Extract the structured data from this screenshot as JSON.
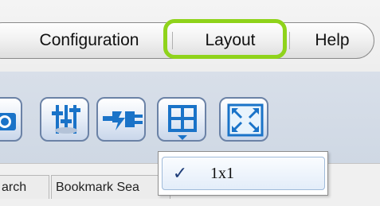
{
  "menubar": {
    "items": [
      {
        "label": "Configuration"
      },
      {
        "label": "Layout"
      },
      {
        "label": "Help"
      }
    ],
    "highlight_color": "#8fd31b"
  },
  "toolbar": {
    "buttons": [
      {
        "icon": "camera-icon"
      },
      {
        "icon": "equalizer-icon"
      },
      {
        "icon": "plug-icon"
      },
      {
        "icon": "grid-layout-icon",
        "has_dropdown": true
      },
      {
        "icon": "fullscreen-icon"
      }
    ],
    "accent_color": "#1a73c8"
  },
  "tabs": [
    {
      "label": "arch"
    },
    {
      "label": "Bookmark Sea"
    }
  ],
  "layout_dropdown": {
    "items": [
      {
        "label": "1x1",
        "checked": true,
        "check_glyph": "✓"
      }
    ]
  }
}
